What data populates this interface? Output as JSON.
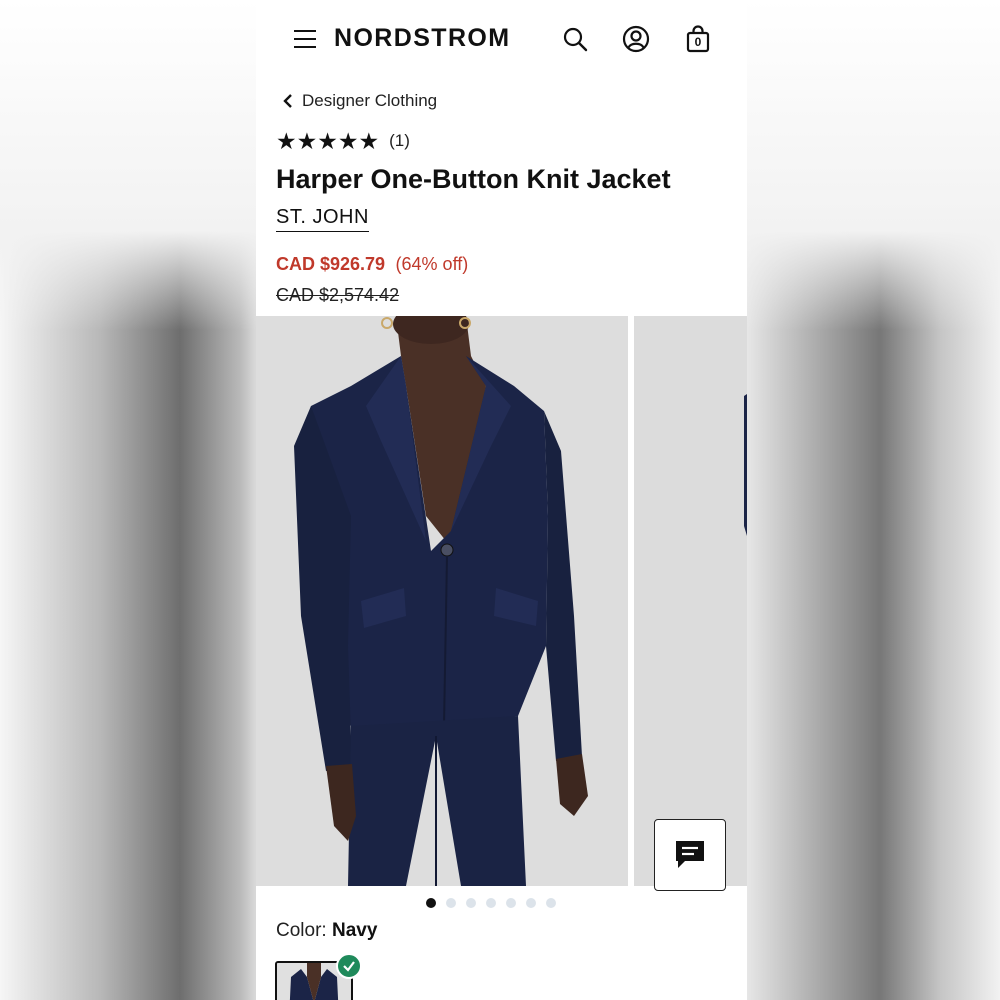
{
  "header": {
    "logo": "NORDSTROM",
    "icons": [
      "menu-icon",
      "search-icon",
      "account-icon",
      "bag-icon"
    ],
    "bag_count": "0"
  },
  "breadcrumb": {
    "label": "Designer Clothing"
  },
  "product": {
    "rating": 5,
    "rating_count": "(1)",
    "title": "Harper One-Button Knit Jacket",
    "brand": "ST. JOHN",
    "sale_price": "CAD $926.79",
    "discount": "(64% off)",
    "original_price": "CAD $2,574.42",
    "color_label": "Color:",
    "color_value": "Navy"
  },
  "gallery": {
    "image_count": 7,
    "active_index": 0
  },
  "colors": {
    "accent_sale": "#c0392b",
    "selected_check": "#1f8a5b",
    "jacket_navy": "#1b2447"
  }
}
